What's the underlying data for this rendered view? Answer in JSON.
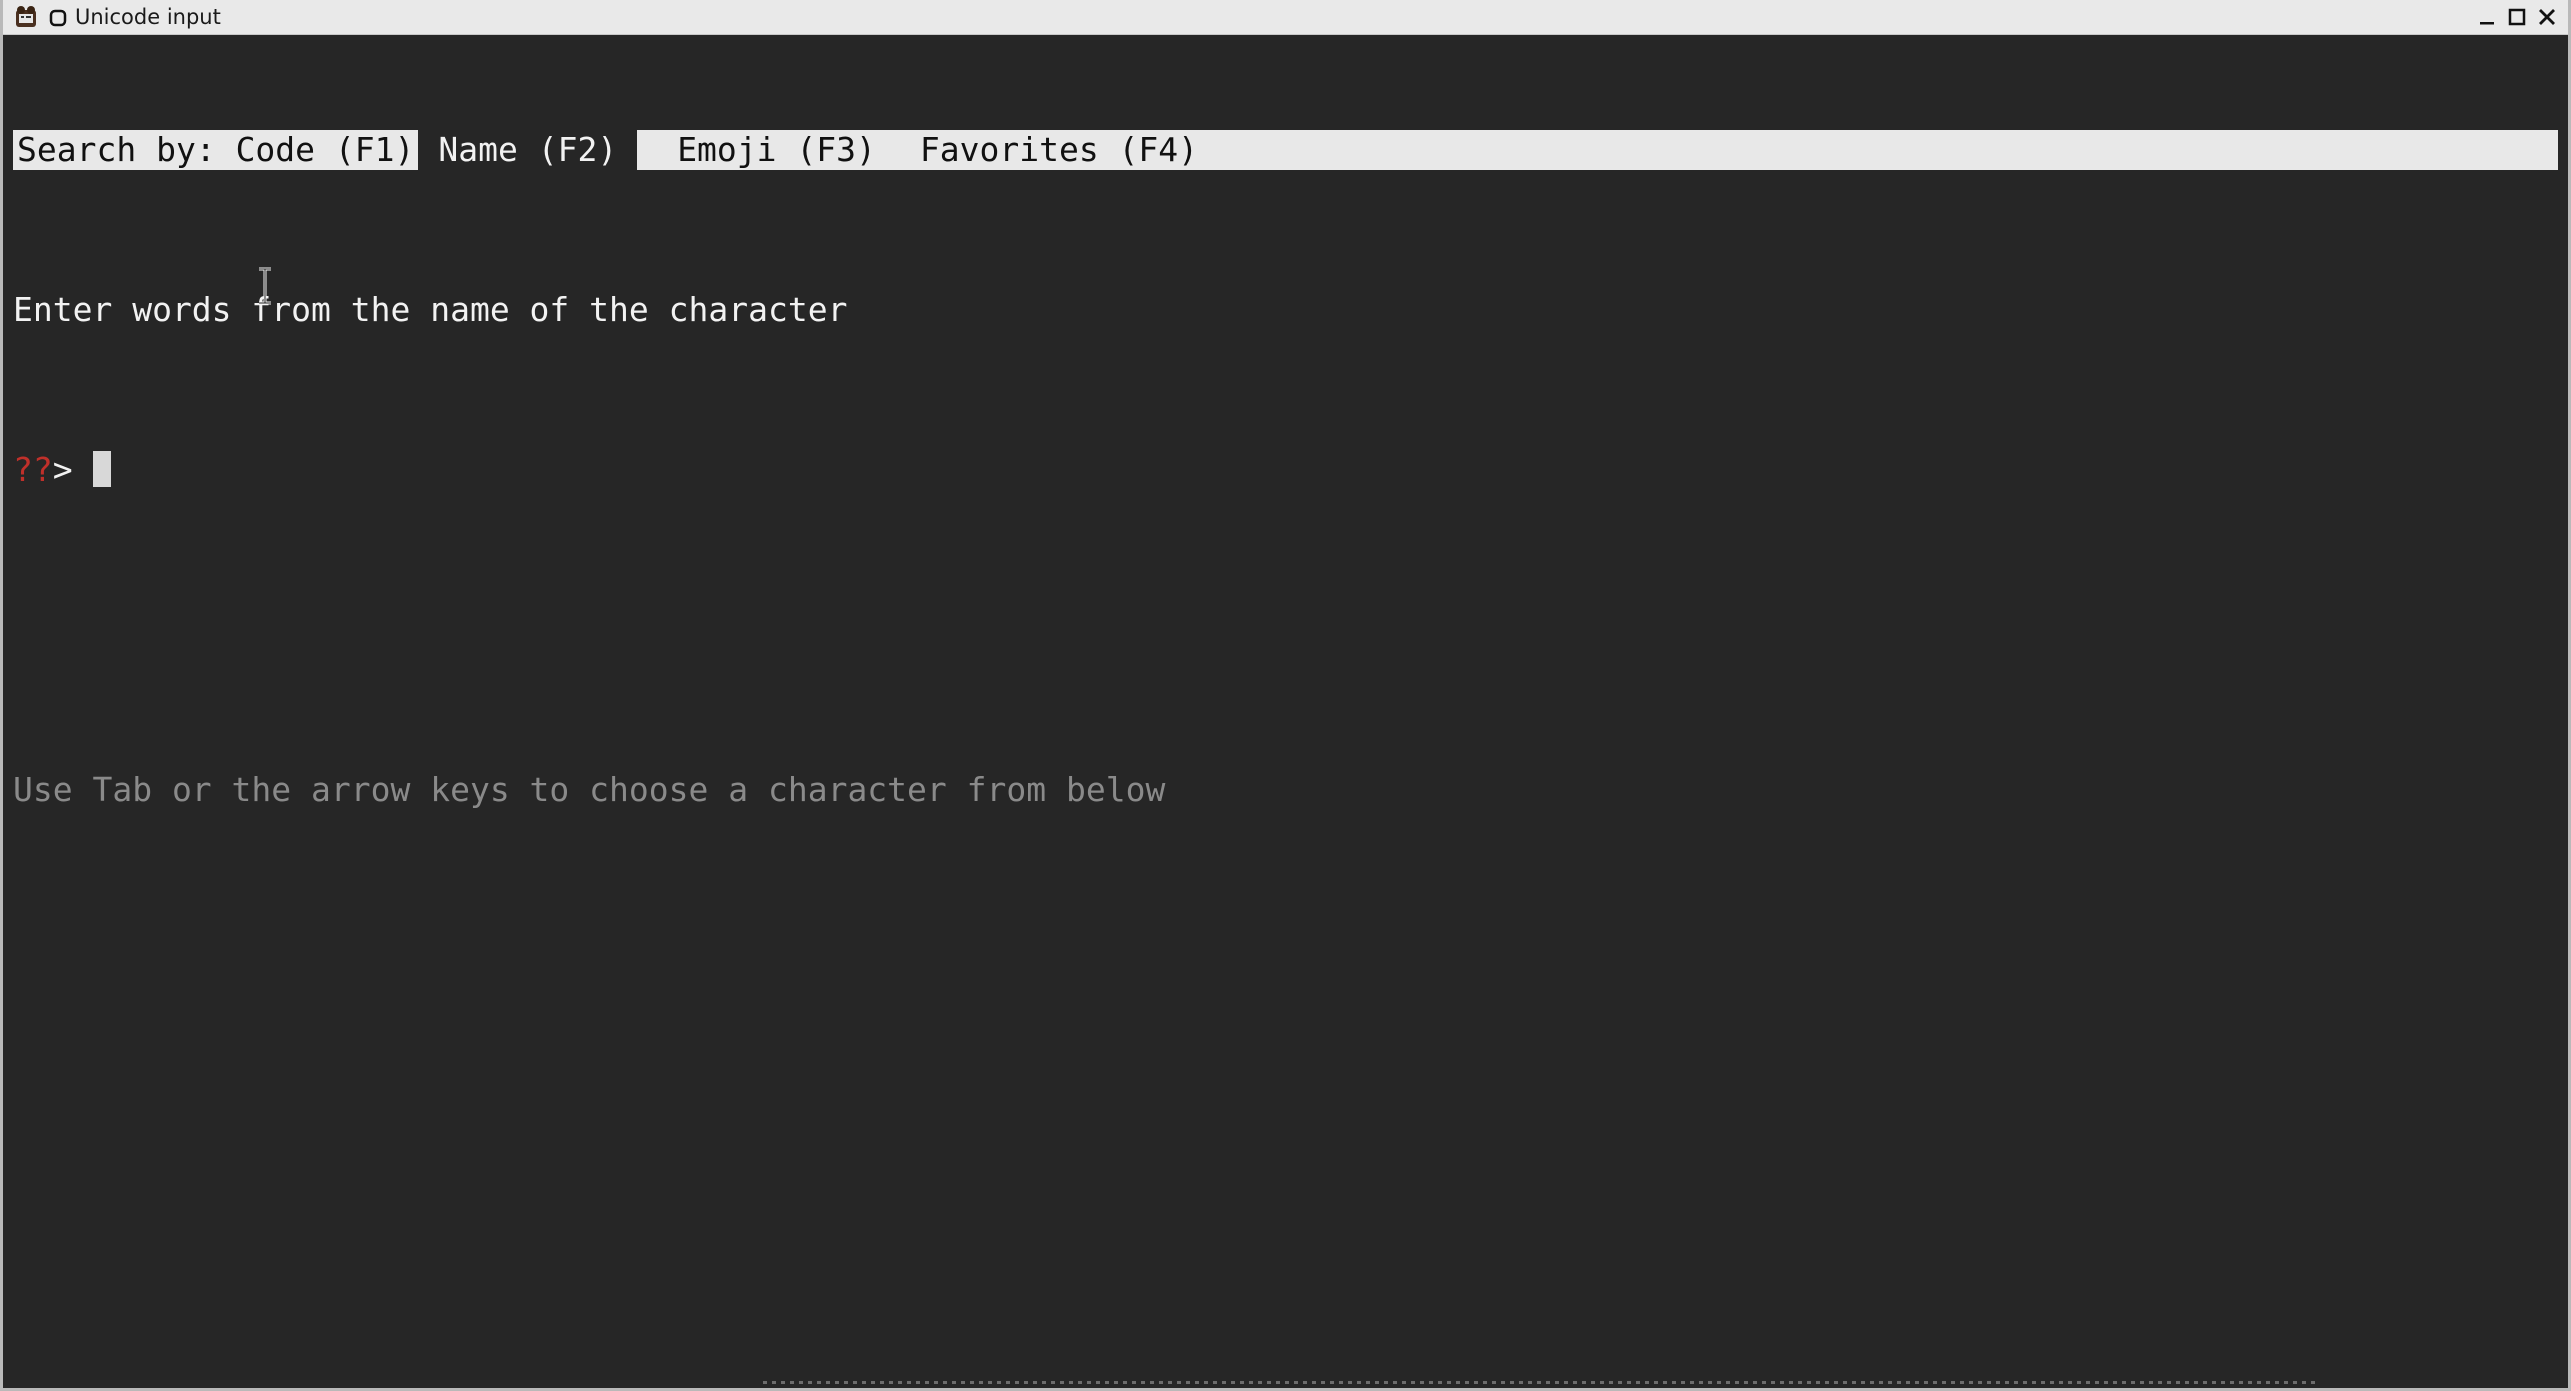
{
  "window": {
    "title": "Unicode input",
    "icons": {
      "app": "terminal-app-icon",
      "system_menu": "system-menu-icon",
      "minimize": "minimize-icon",
      "maximize": "maximize-icon",
      "close": "close-icon"
    }
  },
  "tabs": {
    "prefix": "Search by:",
    "items": [
      {
        "label": "Code (F1)",
        "active": false
      },
      {
        "label": "Name (F2)",
        "active": true
      },
      {
        "label": "Emoji (F3)",
        "active": false
      },
      {
        "label": "Favorites (F4)",
        "active": false
      }
    ]
  },
  "instruction": "Enter words from the name of the character",
  "prompt": {
    "marker": "??",
    "symbol": ">",
    "value": ""
  },
  "hint": "Use Tab or the arrow keys to choose a character from below",
  "colors": {
    "background": "#262626",
    "text": "#f2f2f2",
    "tabbar": "#e8e8e8",
    "prompt_marker": "#c0302a",
    "hint": "#8a8a8a"
  }
}
